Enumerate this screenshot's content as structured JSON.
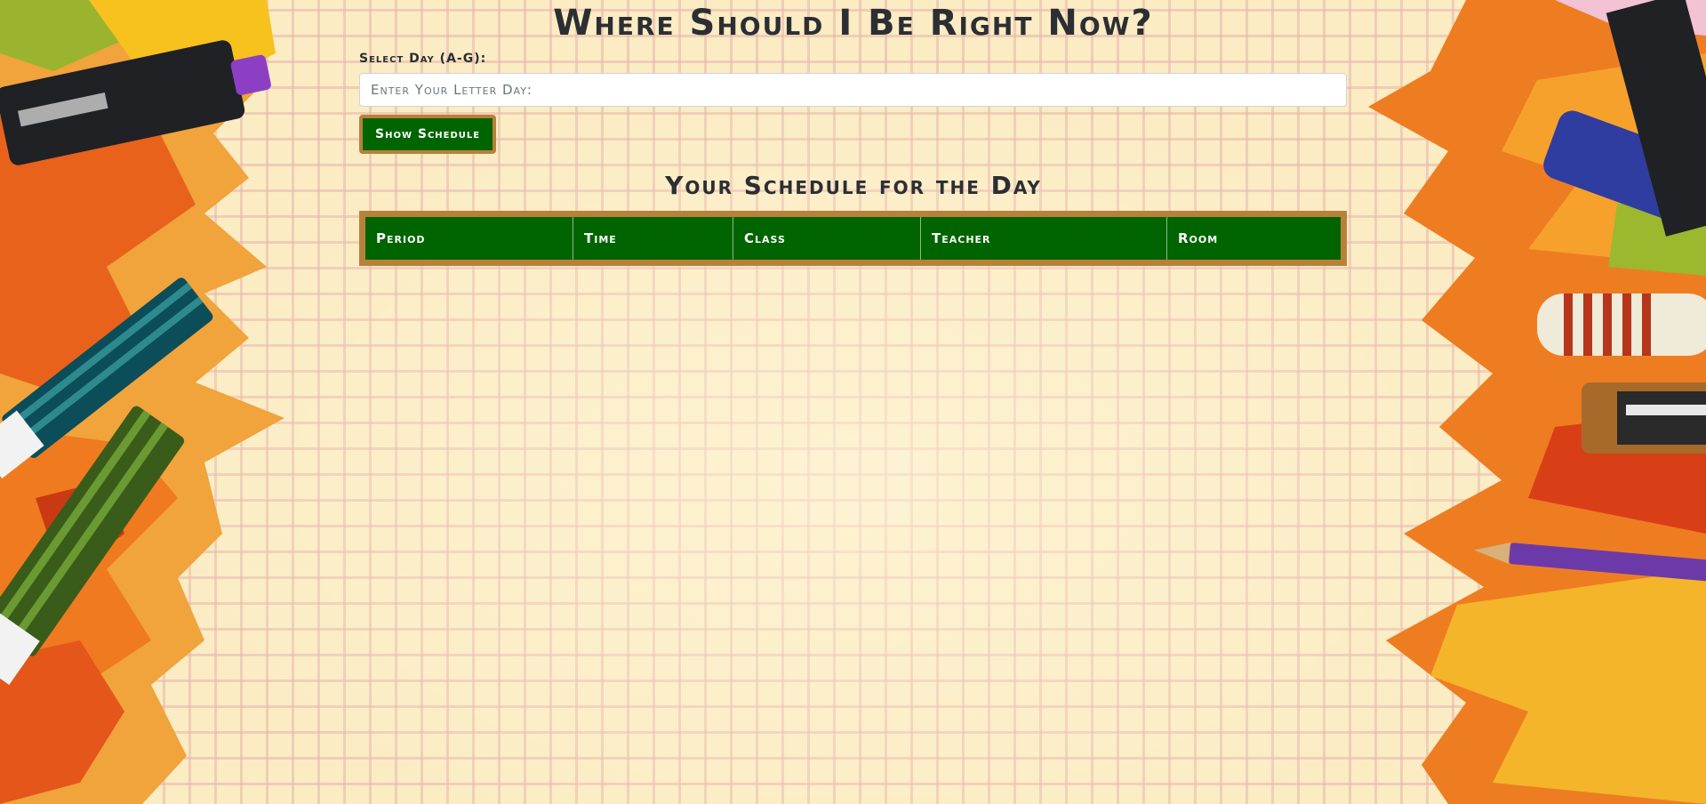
{
  "page": {
    "title": "Where Should I Be Right Now?"
  },
  "form": {
    "label": "Select Day (A-G):",
    "placeholder": "Enter Your Letter Day:",
    "button_label": "Show Schedule"
  },
  "schedule": {
    "title": "Your Schedule for the Day",
    "columns": [
      "Period",
      "Time",
      "Class",
      "Teacher",
      "Room"
    ]
  },
  "colors": {
    "accent_green": "#006400",
    "border_gold": "#b8813a",
    "background": "#fbecc4"
  },
  "decorations": {
    "left": "autumn-leaves-markers-icon",
    "right": "autumn-leaves-pens-icon"
  }
}
